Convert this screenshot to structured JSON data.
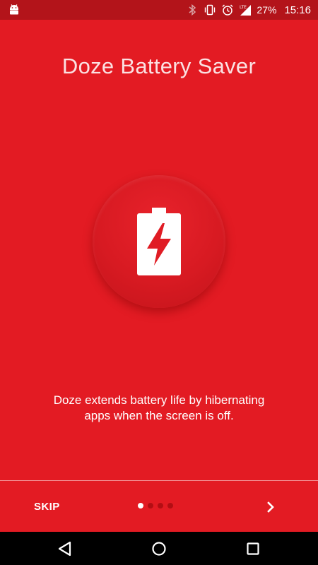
{
  "status_bar": {
    "battery_percent": "27%",
    "time": "15:16",
    "network_label": "LTE",
    "icons": [
      "android-notification-icon",
      "bluetooth-icon",
      "vibrate-icon",
      "alarm-icon",
      "lte-signal-icon"
    ]
  },
  "app": {
    "title": "Doze Battery Saver",
    "icon": "battery-charging-icon",
    "description": "Doze extends battery life by hibernating apps when the screen is off."
  },
  "onboarding": {
    "skip_label": "SKIP",
    "next_icon": "chevron-right-icon",
    "page_count": 4,
    "current_page": 1
  },
  "navigation": {
    "back_icon": "back-triangle-icon",
    "home_icon": "home-circle-icon",
    "recents_icon": "recents-square-icon"
  },
  "colors": {
    "background": "#e31b23",
    "status_bar": "#b3141a",
    "circle": "#d81a22",
    "nav_bar": "#000000"
  }
}
